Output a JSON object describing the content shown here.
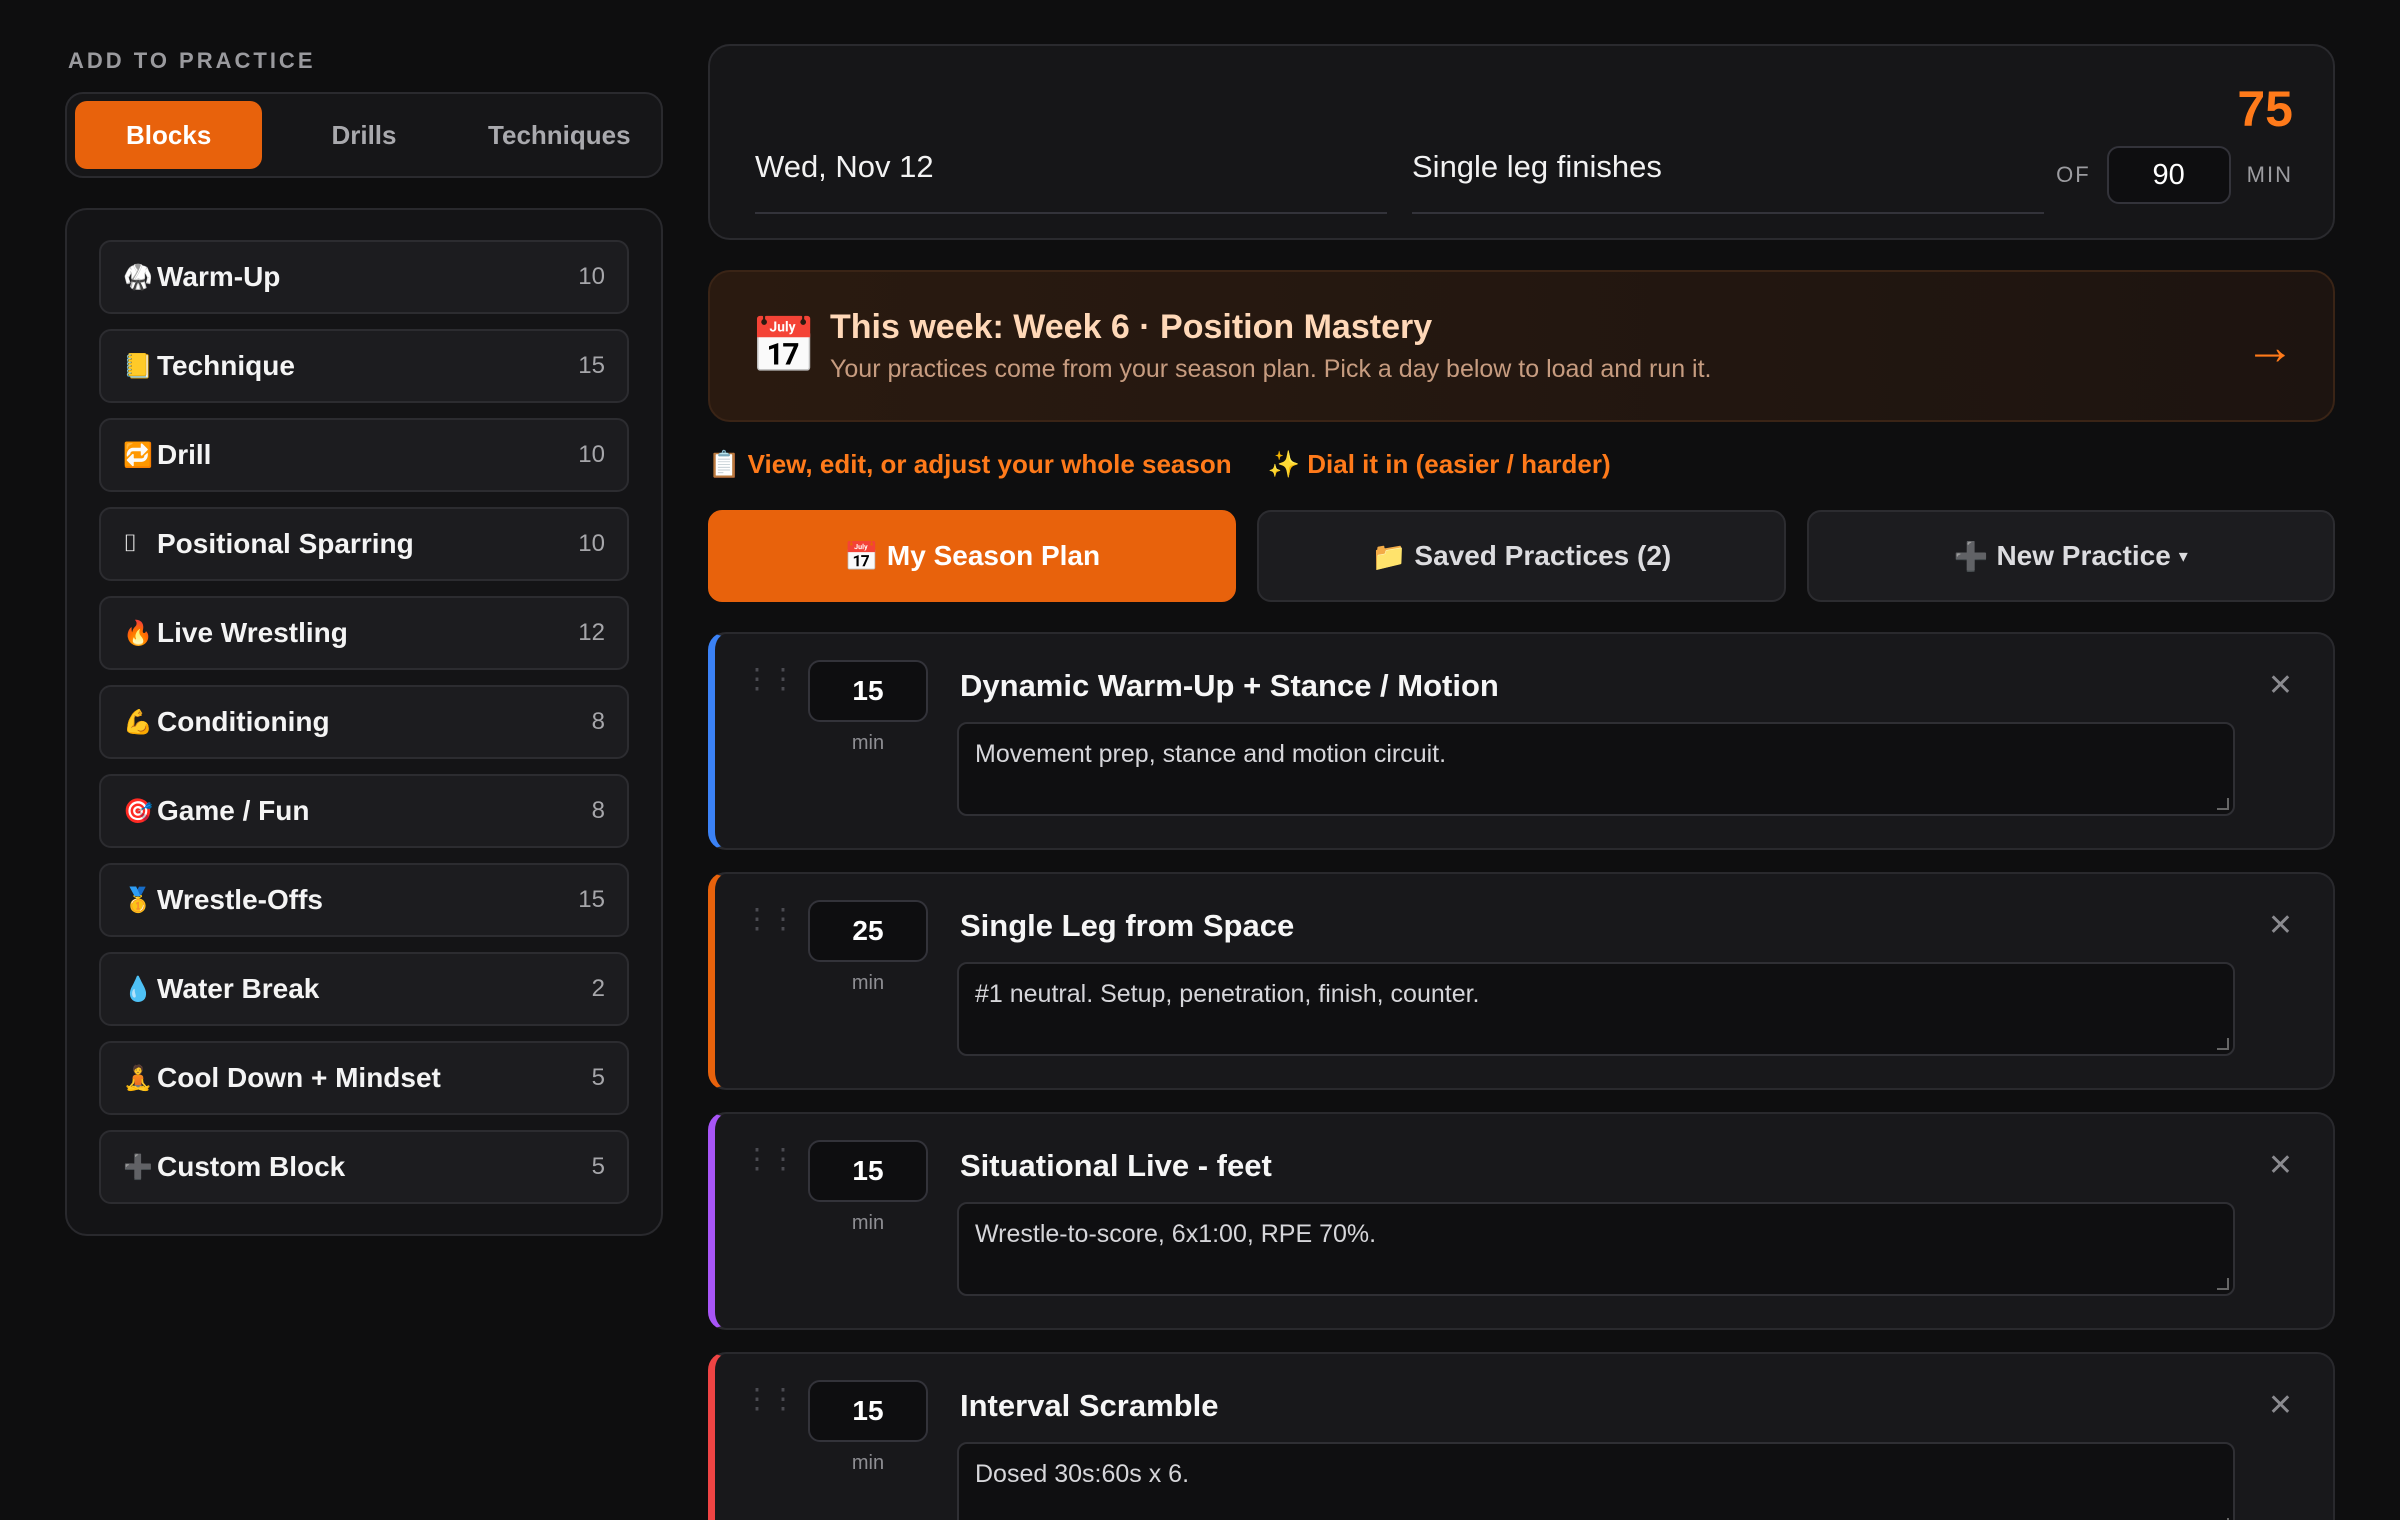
{
  "left": {
    "section_label": "ADD TO PRACTICE",
    "tabs": [
      {
        "label": "Blocks",
        "active": true
      },
      {
        "label": "Drills",
        "active": false
      },
      {
        "label": "Techniques",
        "active": false
      }
    ],
    "blocks": [
      {
        "icon": "🥋",
        "label": "Warm-Up",
        "count": "10"
      },
      {
        "icon": "📒",
        "label": "Technique",
        "count": "15"
      },
      {
        "icon": "🔁",
        "label": "Drill",
        "count": "10"
      },
      {
        "icon": "⌷",
        "label": "Positional Sparring",
        "count": "10"
      },
      {
        "icon": "🔥",
        "label": "Live Wrestling",
        "count": "12"
      },
      {
        "icon": "💪",
        "label": "Conditioning",
        "count": "8"
      },
      {
        "icon": "🎯",
        "label": "Game / Fun",
        "count": "8"
      },
      {
        "icon": "🥇",
        "label": "Wrestle-Offs",
        "count": "15"
      },
      {
        "icon": "💧",
        "label": "Water Break",
        "count": "2"
      },
      {
        "icon": "🧘",
        "label": "Cool Down + Mindset",
        "count": "5"
      },
      {
        "icon": "➕",
        "label": "Custom Block",
        "count": "5"
      }
    ]
  },
  "header": {
    "date": "Wed, Nov 12",
    "focus": "Single leg finishes",
    "total": "75",
    "of_label": "OF",
    "target": "90",
    "unit": "MIN"
  },
  "week": {
    "icon": "📅",
    "title": "This week: Week 6 · Position Mastery",
    "subtitle": "Your practices come from your season plan. Pick a day below to load and run it.",
    "arrow": "→"
  },
  "links": [
    {
      "icon": "📋",
      "label": "View, edit, or adjust your whole season"
    },
    {
      "icon": "✨",
      "label": "Dial it in (easier / harder)"
    }
  ],
  "tabs": [
    {
      "icon": "📅",
      "label": "My Season Plan",
      "active": true
    },
    {
      "icon": "📁",
      "label": "Saved Practices (2)",
      "active": false
    },
    {
      "icon": "➕",
      "label": "New Practice",
      "active": false,
      "caret": "▾"
    }
  ],
  "plan_blocks": [
    {
      "minutes": "15",
      "unit": "min",
      "title": "Dynamic Warm-Up + Stance / Motion",
      "notes": "Movement prep, stance and motion circuit.",
      "accent": "#3b82f6"
    },
    {
      "minutes": "25",
      "unit": "min",
      "title": "Single Leg from Space",
      "notes": "#1 neutral. Setup, penetration, finish, counter.",
      "accent": "#e8620c"
    },
    {
      "minutes": "15",
      "unit": "min",
      "title": "Situational Live - feet",
      "notes": "Wrestle-to-score, 6x1:00, RPE 70%.",
      "accent": "#a855f7"
    },
    {
      "minutes": "15",
      "unit": "min",
      "title": "Interval Scramble",
      "notes": "Dosed 30s:60s x 6.",
      "accent": "#ef4444"
    }
  ]
}
